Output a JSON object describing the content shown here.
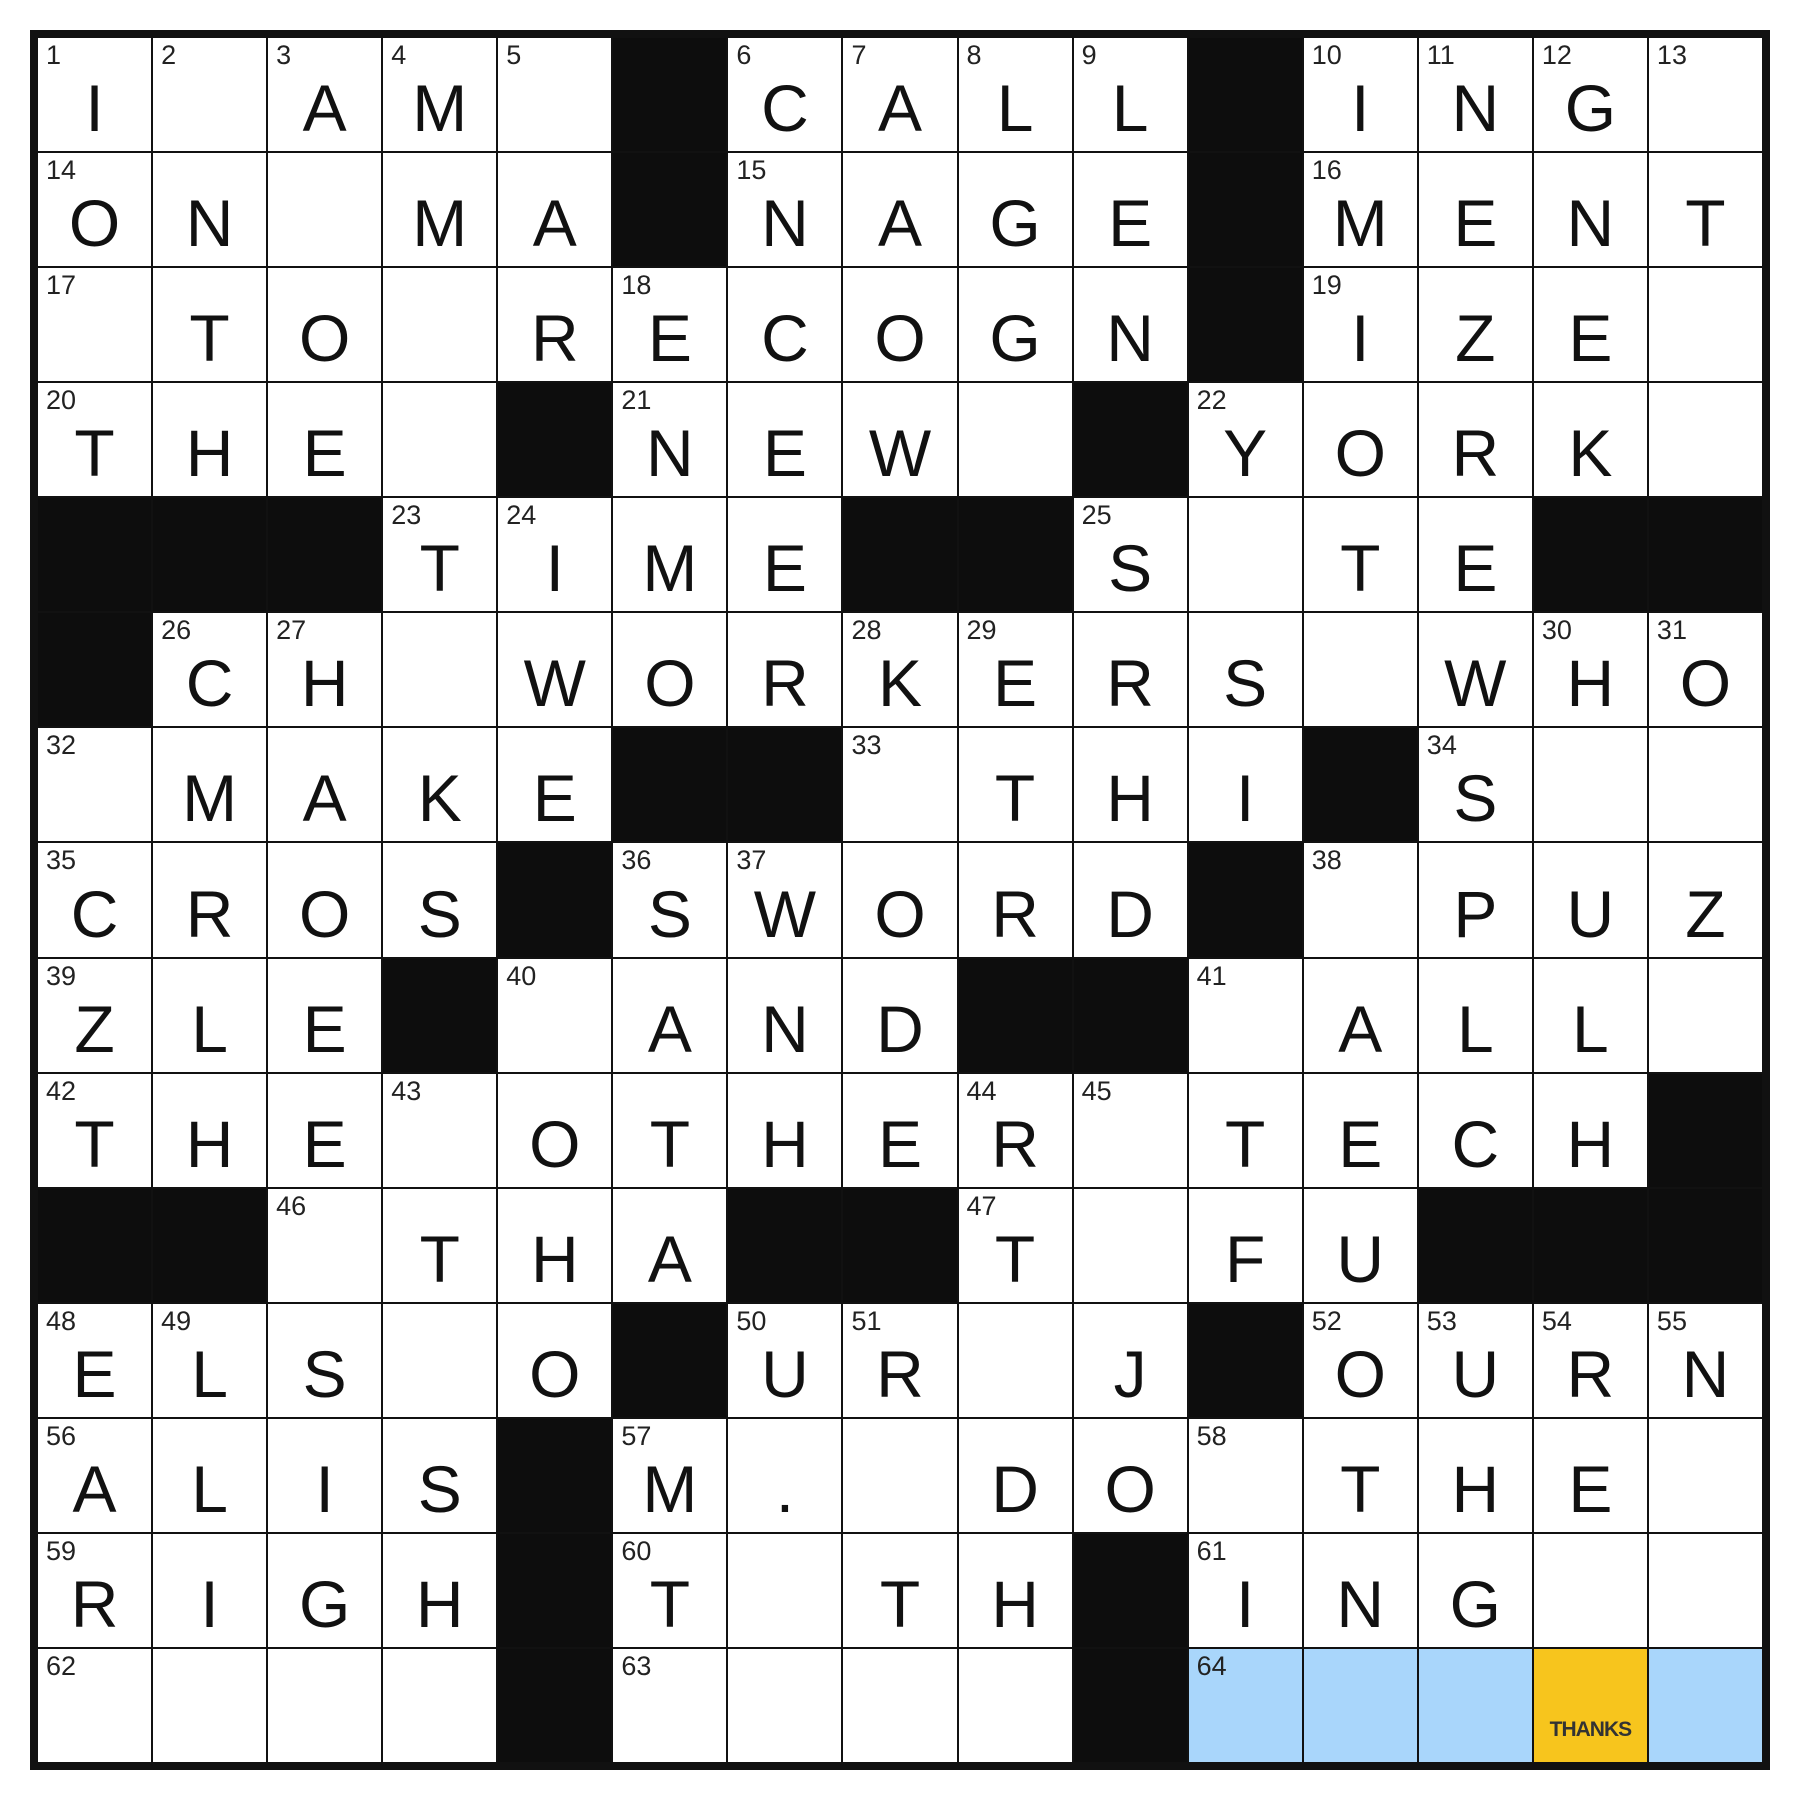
{
  "puzzle": {
    "size": 15,
    "colors": {
      "block": "#0d0d0d",
      "highlight": "#a9d6fb",
      "gold": "#f7c51d",
      "white": "#ffffff"
    },
    "rows": [
      [
        {
          "n": "1",
          "l": "I"
        },
        {
          "n": "2",
          "l": ""
        },
        {
          "n": "3",
          "l": "A"
        },
        {
          "n": "4",
          "l": "M"
        },
        {
          "n": "5",
          "l": ""
        },
        {
          "b": true
        },
        {
          "n": "6",
          "l": "C"
        },
        {
          "n": "7",
          "l": "A"
        },
        {
          "n": "8",
          "l": "L"
        },
        {
          "n": "9",
          "l": "L"
        },
        {
          "b": true
        },
        {
          "n": "10",
          "l": "I"
        },
        {
          "n": "11",
          "l": "N"
        },
        {
          "n": "12",
          "l": "G"
        },
        {
          "n": "13",
          "l": ""
        }
      ],
      [
        {
          "n": "14",
          "l": "O"
        },
        {
          "l": "N"
        },
        {
          "l": ""
        },
        {
          "l": "M"
        },
        {
          "l": "A"
        },
        {
          "b": true
        },
        {
          "n": "15",
          "l": "N"
        },
        {
          "l": "A"
        },
        {
          "l": "G"
        },
        {
          "l": "E"
        },
        {
          "b": true
        },
        {
          "n": "16",
          "l": "M"
        },
        {
          "l": "E"
        },
        {
          "l": "N"
        },
        {
          "l": "T"
        }
      ],
      [
        {
          "n": "17",
          "l": ""
        },
        {
          "l": "T"
        },
        {
          "l": "O"
        },
        {
          "l": ""
        },
        {
          "l": "R"
        },
        {
          "n": "18",
          "l": "E"
        },
        {
          "l": "C"
        },
        {
          "l": "O"
        },
        {
          "l": "G"
        },
        {
          "l": "N"
        },
        {
          "b": true
        },
        {
          "n": "19",
          "l": "I"
        },
        {
          "l": "Z"
        },
        {
          "l": "E"
        },
        {
          "l": ""
        }
      ],
      [
        {
          "n": "20",
          "l": "T"
        },
        {
          "l": "H"
        },
        {
          "l": "E"
        },
        {
          "l": ""
        },
        {
          "b": true
        },
        {
          "n": "21",
          "l": "N"
        },
        {
          "l": "E"
        },
        {
          "l": "W"
        },
        {
          "l": ""
        },
        {
          "b": true
        },
        {
          "n": "22",
          "l": "Y"
        },
        {
          "l": "O"
        },
        {
          "l": "R"
        },
        {
          "l": "K"
        },
        {
          "l": ""
        }
      ],
      [
        {
          "b": true
        },
        {
          "b": true
        },
        {
          "b": true
        },
        {
          "n": "23",
          "l": "T"
        },
        {
          "n": "24",
          "l": "I"
        },
        {
          "l": "M"
        },
        {
          "l": "E"
        },
        {
          "b": true
        },
        {
          "b": true
        },
        {
          "n": "25",
          "l": "S"
        },
        {
          "l": ""
        },
        {
          "l": "T"
        },
        {
          "l": "E"
        },
        {
          "b": true
        },
        {
          "b": true
        }
      ],
      [
        {
          "b": true
        },
        {
          "n": "26",
          "l": "C"
        },
        {
          "n": "27",
          "l": "H"
        },
        {
          "l": ""
        },
        {
          "l": "W"
        },
        {
          "l": "O"
        },
        {
          "l": "R"
        },
        {
          "n": "28",
          "l": "K"
        },
        {
          "n": "29",
          "l": "E"
        },
        {
          "l": "R"
        },
        {
          "l": "S"
        },
        {
          "l": ""
        },
        {
          "l": "W"
        },
        {
          "n": "30",
          "l": "H"
        },
        {
          "n": "31",
          "l": "O"
        }
      ],
      [
        {
          "n": "32",
          "l": ""
        },
        {
          "l": "M"
        },
        {
          "l": "A"
        },
        {
          "l": "K"
        },
        {
          "l": "E"
        },
        {
          "b": true
        },
        {
          "b": true
        },
        {
          "n": "33",
          "l": ""
        },
        {
          "l": "T"
        },
        {
          "l": "H"
        },
        {
          "l": "I"
        },
        {
          "b": true
        },
        {
          "n": "34",
          "l": "S"
        },
        {
          "l": ""
        },
        {
          "l": ""
        }
      ],
      [
        {
          "n": "35",
          "l": "C"
        },
        {
          "l": "R"
        },
        {
          "l": "O"
        },
        {
          "l": "S"
        },
        {
          "b": true
        },
        {
          "n": "36",
          "l": "S"
        },
        {
          "n": "37",
          "l": "W"
        },
        {
          "l": "O"
        },
        {
          "l": "R"
        },
        {
          "l": "D"
        },
        {
          "b": true
        },
        {
          "n": "38",
          "l": ""
        },
        {
          "l": "P"
        },
        {
          "l": "U"
        },
        {
          "l": "Z"
        }
      ],
      [
        {
          "n": "39",
          "l": "Z"
        },
        {
          "l": "L"
        },
        {
          "l": "E"
        },
        {
          "b": true
        },
        {
          "n": "40",
          "l": ""
        },
        {
          "l": "A"
        },
        {
          "l": "N"
        },
        {
          "l": "D"
        },
        {
          "b": true
        },
        {
          "b": true
        },
        {
          "n": "41",
          "l": ""
        },
        {
          "l": "A"
        },
        {
          "l": "L"
        },
        {
          "l": "L"
        },
        {
          "l": ""
        }
      ],
      [
        {
          "n": "42",
          "l": "T"
        },
        {
          "l": "H"
        },
        {
          "l": "E"
        },
        {
          "n": "43",
          "l": ""
        },
        {
          "l": "O"
        },
        {
          "l": "T"
        },
        {
          "l": "H"
        },
        {
          "l": "E"
        },
        {
          "n": "44",
          "l": "R"
        },
        {
          "n": "45",
          "l": ""
        },
        {
          "l": "T"
        },
        {
          "l": "E"
        },
        {
          "l": "C"
        },
        {
          "l": "H"
        },
        {
          "b": true
        }
      ],
      [
        {
          "b": true
        },
        {
          "b": true
        },
        {
          "n": "46",
          "l": ""
        },
        {
          "l": "T"
        },
        {
          "l": "H"
        },
        {
          "l": "A"
        },
        {
          "b": true
        },
        {
          "b": true
        },
        {
          "n": "47",
          "l": "T"
        },
        {
          "l": ""
        },
        {
          "l": "F"
        },
        {
          "l": "U"
        },
        {
          "b": true
        },
        {
          "b": true
        },
        {
          "b": true
        }
      ],
      [
        {
          "n": "48",
          "l": "E"
        },
        {
          "n": "49",
          "l": "L"
        },
        {
          "l": "S"
        },
        {
          "l": ""
        },
        {
          "l": "O"
        },
        {
          "b": true
        },
        {
          "n": "50",
          "l": "U"
        },
        {
          "n": "51",
          "l": "R"
        },
        {
          "l": ""
        },
        {
          "l": "J"
        },
        {
          "b": true
        },
        {
          "n": "52",
          "l": "O"
        },
        {
          "n": "53",
          "l": "U"
        },
        {
          "n": "54",
          "l": "R"
        },
        {
          "n": "55",
          "l": "N"
        }
      ],
      [
        {
          "n": "56",
          "l": "A"
        },
        {
          "l": "L"
        },
        {
          "l": "I"
        },
        {
          "l": "S"
        },
        {
          "b": true
        },
        {
          "n": "57",
          "l": "M"
        },
        {
          "l": "."
        },
        {
          "l": ""
        },
        {
          "l": "D"
        },
        {
          "l": "O"
        },
        {
          "n": "58",
          "l": ""
        },
        {
          "l": "T"
        },
        {
          "l": "H"
        },
        {
          "l": "E"
        },
        {
          "l": ""
        }
      ],
      [
        {
          "n": "59",
          "l": "R"
        },
        {
          "l": "I"
        },
        {
          "l": "G"
        },
        {
          "l": "H"
        },
        {
          "b": true
        },
        {
          "n": "60",
          "l": "T"
        },
        {
          "l": ""
        },
        {
          "l": "T"
        },
        {
          "l": "H"
        },
        {
          "b": true
        },
        {
          "n": "61",
          "l": "I"
        },
        {
          "l": "N"
        },
        {
          "l": "G"
        },
        {
          "l": ""
        },
        {
          "l": ""
        }
      ],
      [
        {
          "n": "62",
          "l": ""
        },
        {
          "l": ""
        },
        {
          "l": ""
        },
        {
          "l": ""
        },
        {
          "b": true
        },
        {
          "n": "63",
          "l": ""
        },
        {
          "l": ""
        },
        {
          "l": ""
        },
        {
          "l": ""
        },
        {
          "b": true
        },
        {
          "n": "64",
          "l": "",
          "hl": true
        },
        {
          "l": "",
          "hl": true
        },
        {
          "l": "",
          "hl": true
        },
        {
          "l": "",
          "gold": true,
          "note": "THANKS"
        },
        {
          "l": "",
          "hl": true
        }
      ]
    ]
  }
}
